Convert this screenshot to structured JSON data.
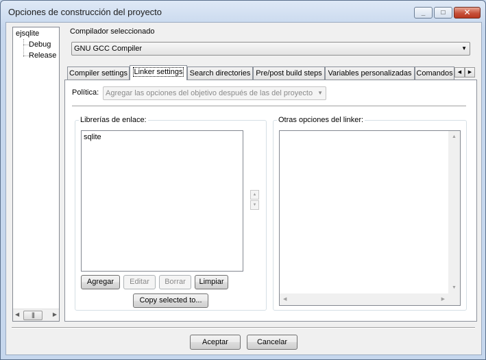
{
  "window": {
    "title": "Opciones de construcción del proyecto",
    "minimize_glyph": "_",
    "maximize_glyph": "□",
    "close_glyph": "✕"
  },
  "tree": {
    "items": [
      {
        "label": "ejsqlite",
        "level": 0
      },
      {
        "label": "Debug",
        "level": 1
      },
      {
        "label": "Release",
        "level": 1
      }
    ]
  },
  "compiler": {
    "label": "Compilador seleccionado",
    "value": "GNU GCC Compiler"
  },
  "tabs": [
    {
      "label": "Compiler settings",
      "active": false
    },
    {
      "label": "Linker settings",
      "active": true
    },
    {
      "label": "Search directories",
      "active": false
    },
    {
      "label": "Pre/post build steps",
      "active": false
    },
    {
      "label": "Variables personalizadas",
      "active": false
    },
    {
      "label": "Comandos",
      "active": false
    }
  ],
  "linker": {
    "policy_label": "Política:",
    "policy_value": "Agregar las opciones del objetivo después de las del proyecto",
    "libraries_label": "Librerías de enlace:",
    "libraries": [
      "sqlite"
    ],
    "other_options_label": "Otras opciones del linker:",
    "buttons": {
      "add": "Agregar",
      "edit": "Editar",
      "delete": "Borrar",
      "clear": "Limpiar",
      "copy": "Copy selected to..."
    }
  },
  "footer": {
    "accept": "Aceptar",
    "cancel": "Cancelar"
  },
  "icons": {
    "up": "▲",
    "down": "▼",
    "left": "◀",
    "right": "▶",
    "grip": "|||"
  }
}
